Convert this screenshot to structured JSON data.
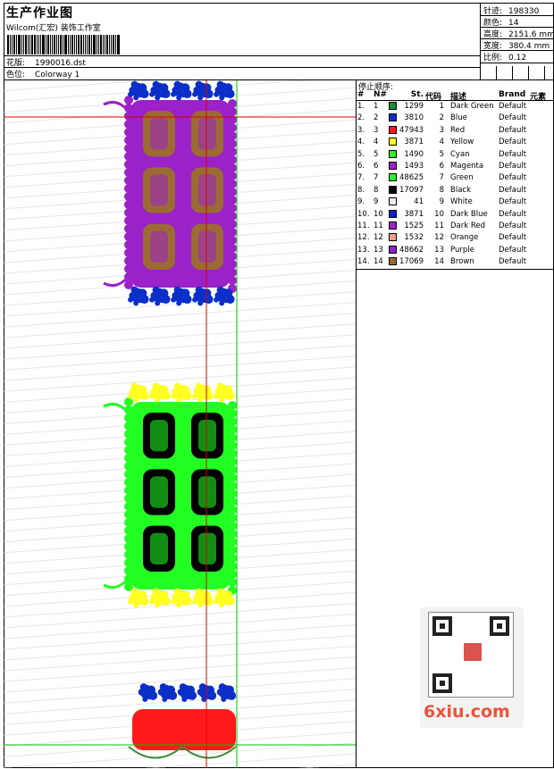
{
  "header": {
    "title": "生产作业图",
    "company": "Wilcom(汇宏) 装饰工作室",
    "design_label": "花版:",
    "design_value": "1990016.dst",
    "colorway_label": "色位:",
    "colorway_value": "Colorway 1"
  },
  "stats": [
    {
      "label": "针迹:",
      "value": "198330"
    },
    {
      "label": "颜色:",
      "value": "14"
    },
    {
      "label": "高度:",
      "value": "2151.6 mm"
    },
    {
      "label": "宽度:",
      "value": "380.4 mm"
    },
    {
      "label": "比例:",
      "value": "0.12"
    }
  ],
  "sequence": {
    "title": "停止顺序:",
    "headers": [
      "#",
      "N#",
      "St.",
      "代码",
      "描述",
      "Brand",
      "元素"
    ],
    "rows": [
      {
        "n": "1.",
        "nn": "1",
        "color": "#1b8a3a",
        "st": "1299",
        "code": "1",
        "desc": "Dark Green",
        "brand": "Default"
      },
      {
        "n": "2.",
        "nn": "2",
        "color": "#0b2fc8",
        "st": "3810",
        "code": "2",
        "desc": "Blue",
        "brand": "Default"
      },
      {
        "n": "3.",
        "nn": "3",
        "color": "#ff1a1a",
        "st": "47943",
        "code": "3",
        "desc": "Red",
        "brand": "Default"
      },
      {
        "n": "4.",
        "nn": "4",
        "color": "#ffff22",
        "st": "3871",
        "code": "4",
        "desc": "Yellow",
        "brand": "Default"
      },
      {
        "n": "5.",
        "nn": "5",
        "color": "#33ee22",
        "st": "1490",
        "code": "5",
        "desc": "Cyan",
        "brand": "Default"
      },
      {
        "n": "6.",
        "nn": "6",
        "color": "#9a22c8",
        "st": "1493",
        "code": "6",
        "desc": "Magenta",
        "brand": "Default"
      },
      {
        "n": "7.",
        "nn": "7",
        "color": "#22ff22",
        "st": "48625",
        "code": "7",
        "desc": "Green",
        "brand": "Default"
      },
      {
        "n": "8.",
        "nn": "8",
        "color": "#000000",
        "st": "17097",
        "code": "8",
        "desc": "Black",
        "brand": "Default"
      },
      {
        "n": "9.",
        "nn": "9",
        "color": "#eeeeee",
        "st": "41",
        "code": "9",
        "desc": "White",
        "brand": "Default"
      },
      {
        "n": "10.",
        "nn": "10",
        "color": "#0b22c0",
        "st": "3871",
        "code": "10",
        "desc": "Dark Blue",
        "brand": "Default"
      },
      {
        "n": "11.",
        "nn": "11",
        "color": "#9a22c8",
        "st": "1525",
        "code": "11",
        "desc": "Dark Red",
        "brand": "Default"
      },
      {
        "n": "12.",
        "nn": "12",
        "color": "#f29b8f",
        "st": "1532",
        "code": "12",
        "desc": "Orange",
        "brand": "Default"
      },
      {
        "n": "13.",
        "nn": "13",
        "color": "#8e22c8",
        "st": "48662",
        "code": "13",
        "desc": "Purple",
        "brand": "Default"
      },
      {
        "n": "14.",
        "nn": "14",
        "color": "#9b6a35",
        "st": "17069",
        "code": "14",
        "desc": "Brown",
        "brand": "Default"
      }
    ]
  },
  "watermark": {
    "text": "6xiu.com"
  },
  "colors": {
    "purple": "#9a22c8",
    "brown": "#9b6a35",
    "blue": "#0b2fc8",
    "green": "#22ff22",
    "yellow": "#ffff22",
    "black": "#000000",
    "red": "#ff1a1a",
    "guide_red": "#e00000",
    "guide_green": "#00c000"
  }
}
